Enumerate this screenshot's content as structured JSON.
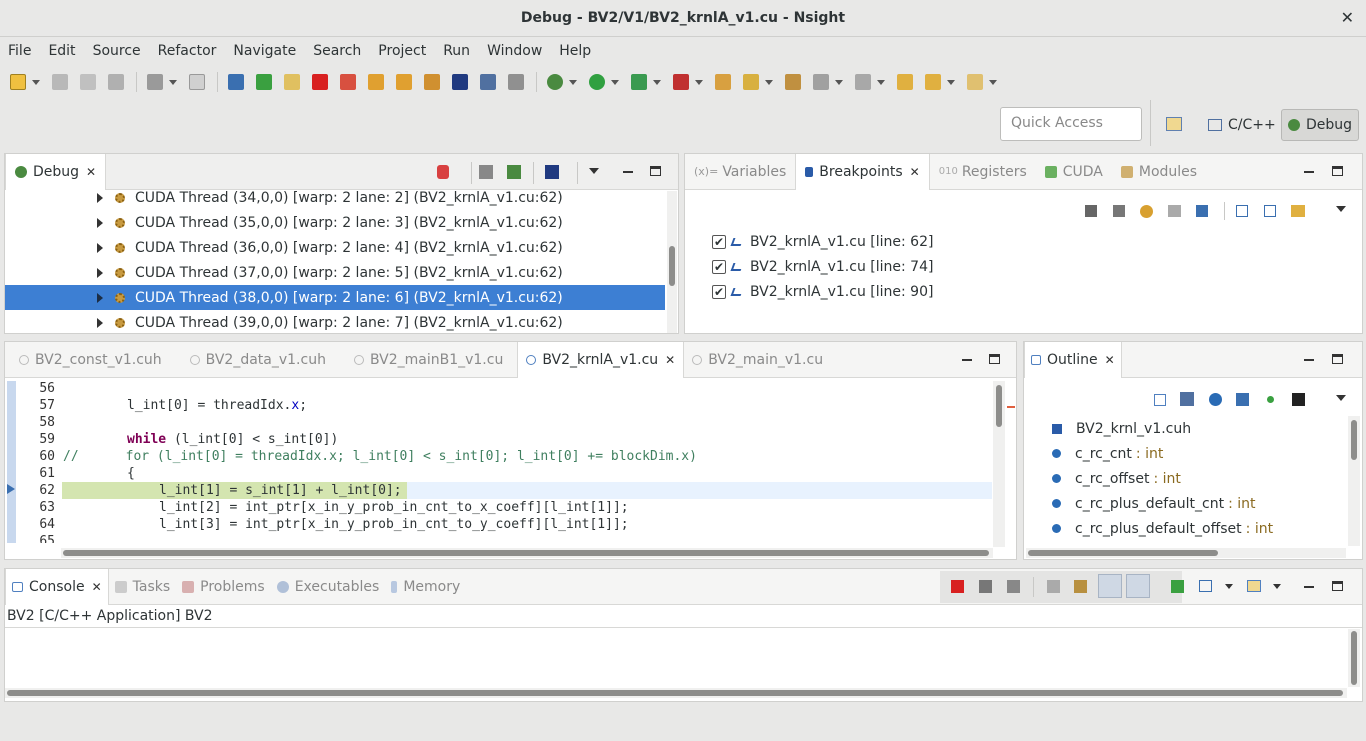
{
  "window": {
    "title": "Debug - BV2/V1/BV2_krnlA_v1.cu - Nsight",
    "close": "✕"
  },
  "menu": [
    "File",
    "Edit",
    "Source",
    "Refactor",
    "Navigate",
    "Search",
    "Project",
    "Run",
    "Window",
    "Help"
  ],
  "quick_access": {
    "placeholder": "Quick Access"
  },
  "perspectives": {
    "cc": "C/C++",
    "debug": "Debug"
  },
  "debug_view": {
    "tab": "Debug",
    "threads": [
      "CUDA Thread (34,0,0) [warp: 2 lane: 2] (BV2_krnlA_v1.cu:62)",
      "CUDA Thread (35,0,0) [warp: 2 lane: 3] (BV2_krnlA_v1.cu:62)",
      "CUDA Thread (36,0,0) [warp: 2 lane: 4] (BV2_krnlA_v1.cu:62)",
      "CUDA Thread (37,0,0) [warp: 2 lane: 5] (BV2_krnlA_v1.cu:62)",
      "CUDA Thread (38,0,0) [warp: 2 lane: 6] (BV2_krnlA_v1.cu:62)",
      "CUDA Thread (39,0,0) [warp: 2 lane: 7] (BV2_krnlA_v1.cu:62)"
    ],
    "selected_index": 4
  },
  "right_tabs": {
    "variables": "Variables",
    "breakpoints": "Breakpoints",
    "registers": "Registers",
    "cuda": "CUDA",
    "modules": "Modules"
  },
  "breakpoints": [
    "BV2_krnlA_v1.cu [line: 62]",
    "BV2_krnlA_v1.cu [line: 74]",
    "BV2_krnlA_v1.cu [line: 90]"
  ],
  "editor_tabs": [
    "BV2_const_v1.cuh",
    "BV2_data_v1.cuh",
    "BV2_mainB1_v1.cu",
    "BV2_krnlA_v1.cu",
    "BV2_main_v1.cu"
  ],
  "editor_active_tab": "BV2_krnlA_v1.cu",
  "code": {
    "line_numbers": [
      "56",
      "57",
      "58",
      "59",
      "60",
      "61",
      "62",
      "63",
      "64",
      "65"
    ],
    "l57a": "l_int[0] = threadIdx.",
    "l57b": "x",
    "l57c": ";",
    "l59kw": "while",
    "l59": " (l_int[0] < s_int[0])",
    "l60": "//      for (l_int[0] = threadIdx.x; l_int[0] < s_int[0]; l_int[0] += blockDim.x)",
    "l61": "{",
    "l62": "l_int[1] = s_int[1] + l_int[0];",
    "l63": "l_int[2] = int_ptr[x_in_y_prob_in_cnt_to_x_coeff][l_int[1]];",
    "l64": "l_int[3] = int_ptr[x_in_y_prob_in_cnt_to_y_coeff][l_int[1]];"
  },
  "outline": {
    "tab": "Outline",
    "items": [
      {
        "name": "BV2_krnl_v1.cuh",
        "type": ""
      },
      {
        "name": "c_rc_cnt",
        "type": ": int"
      },
      {
        "name": "c_rc_offset",
        "type": ": int"
      },
      {
        "name": "c_rc_plus_default_cnt",
        "type": ": int"
      },
      {
        "name": "c_rc_plus_default_offset",
        "type": ": int"
      }
    ]
  },
  "bottom_tabs": {
    "console": "Console",
    "tasks": "Tasks",
    "problems": "Problems",
    "executables": "Executables",
    "memory": "Memory"
  },
  "console": {
    "text": "BV2 [C/C++ Application] BV2"
  },
  "colors": {
    "selection": "#3d7fd3",
    "current_line": "#d4e5b0",
    "keyword": "#7f0055",
    "comment": "#3f7f5f"
  }
}
